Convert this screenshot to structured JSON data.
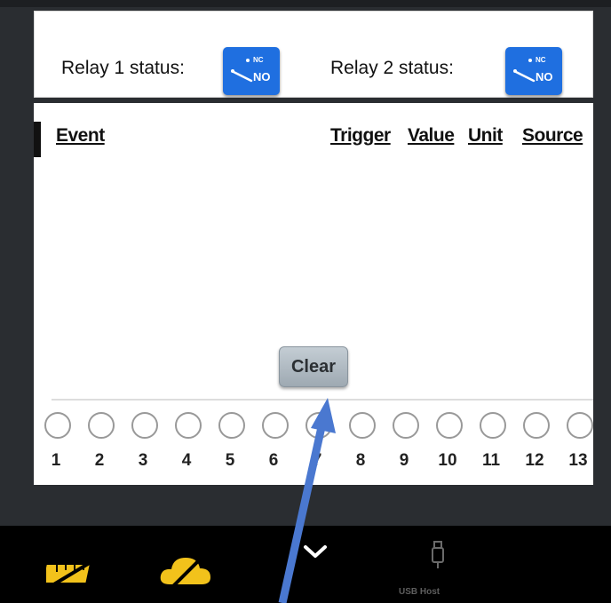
{
  "relays": [
    {
      "label": "Relay 1 status:",
      "nc_text": "NC",
      "no_text": "NO"
    },
    {
      "label": "Relay 2 status:",
      "nc_text": "NC",
      "no_text": "NO"
    }
  ],
  "event_table": {
    "headers": {
      "event": "Event",
      "trigger": "Trigger",
      "value": "Value",
      "unit": "Unit",
      "source": "Source"
    },
    "clear_label": "Clear",
    "channels": [
      "1",
      "2",
      "3",
      "4",
      "5",
      "6",
      "7",
      "8",
      "9",
      "10",
      "11",
      "12",
      "13"
    ]
  },
  "bottom_bar": {
    "usb_label": "USB Host",
    "icons": [
      "ruler-disabled-icon",
      "cloud-disabled-icon",
      "chevron-down-icon",
      "usb-icon"
    ]
  },
  "colors": {
    "relay_button": "#1f6fe0",
    "accent_yellow": "#f2c21b",
    "arrow": "#4a78d0"
  }
}
